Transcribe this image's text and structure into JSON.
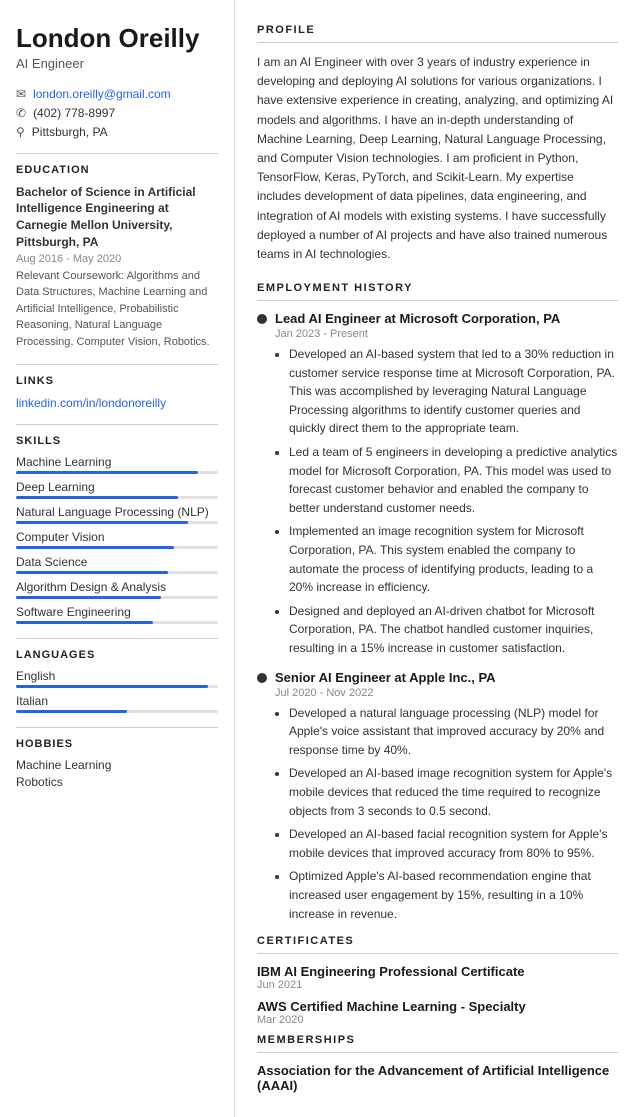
{
  "sidebar": {
    "name": "London Oreilly",
    "job_title": "AI Engineer",
    "contact": {
      "email": "london.oreilly@gmail.com",
      "phone": "(402) 778-8997",
      "location": "Pittsburgh, PA"
    },
    "education_section": "EDUCATION",
    "education": {
      "degree": "Bachelor of Science in Artificial Intelligence Engineering at Carnegie Mellon University, Pittsburgh, PA",
      "date": "Aug 2016 - May 2020",
      "coursework": "Relevant Coursework: Algorithms and Data Structures, Machine Learning and Artificial Intelligence, Probabilistic Reasoning, Natural Language Processing, Computer Vision, Robotics."
    },
    "links_section": "LINKS",
    "link": "linkedin.com/in/londonoreilly",
    "skills_section": "SKILLS",
    "skills": [
      {
        "label": "Machine Learning",
        "pct": 90
      },
      {
        "label": "Deep Learning",
        "pct": 80
      },
      {
        "label": "Natural Language Processing (NLP)",
        "pct": 85
      },
      {
        "label": "Computer Vision",
        "pct": 78
      },
      {
        "label": "Data Science",
        "pct": 75
      },
      {
        "label": "Algorithm Design & Analysis",
        "pct": 72
      },
      {
        "label": "Software Engineering",
        "pct": 68
      }
    ],
    "languages_section": "LANGUAGES",
    "languages": [
      {
        "label": "English",
        "pct": 95
      },
      {
        "label": "Italian",
        "pct": 55
      }
    ],
    "hobbies_section": "HOBBIES",
    "hobbies": [
      "Machine Learning",
      "Robotics"
    ]
  },
  "main": {
    "profile_section": "PROFILE",
    "profile_text": "I am an AI Engineer with over 3 years of industry experience in developing and deploying AI solutions for various organizations. I have extensive experience in creating, analyzing, and optimizing AI models and algorithms. I have an in-depth understanding of Machine Learning, Deep Learning, Natural Language Processing, and Computer Vision technologies. I am proficient in Python, TensorFlow, Keras, PyTorch, and Scikit-Learn. My expertise includes development of data pipelines, data engineering, and integration of AI models with existing systems. I have successfully deployed a number of AI projects and have also trained numerous teams in AI technologies.",
    "employment_section": "EMPLOYMENT HISTORY",
    "jobs": [
      {
        "title": "Lead AI Engineer at Microsoft Corporation, PA",
        "date": "Jan 2023 - Present",
        "bullets": [
          "Developed an AI-based system that led to a 30% reduction in customer service response time at Microsoft Corporation, PA. This was accomplished by leveraging Natural Language Processing algorithms to identify customer queries and quickly direct them to the appropriate team.",
          "Led a team of 5 engineers in developing a predictive analytics model for Microsoft Corporation, PA. This model was used to forecast customer behavior and enabled the company to better understand customer needs.",
          "Implemented an image recognition system for Microsoft Corporation, PA. This system enabled the company to automate the process of identifying products, leading to a 20% increase in efficiency.",
          "Designed and deployed an AI-driven chatbot for Microsoft Corporation, PA. The chatbot handled customer inquiries, resulting in a 15% increase in customer satisfaction."
        ]
      },
      {
        "title": "Senior AI Engineer at Apple Inc., PA",
        "date": "Jul 2020 - Nov 2022",
        "bullets": [
          "Developed a natural language processing (NLP) model for Apple's voice assistant that improved accuracy by 20% and response time by 40%.",
          "Developed an AI-based image recognition system for Apple's mobile devices that reduced the time required to recognize objects from 3 seconds to 0.5 second.",
          "Developed an AI-based facial recognition system for Apple's mobile devices that improved accuracy from 80% to 95%.",
          "Optimized Apple's AI-based recommendation engine that increased user engagement by 15%, resulting in a 10% increase in revenue."
        ]
      }
    ],
    "certificates_section": "CERTIFICATES",
    "certificates": [
      {
        "title": "IBM AI Engineering Professional Certificate",
        "date": "Jun 2021"
      },
      {
        "title": "AWS Certified Machine Learning - Specialty",
        "date": "Mar 2020"
      }
    ],
    "memberships_section": "MEMBERSHIPS",
    "memberships": [
      {
        "title": "Association for the Advancement of Artificial Intelligence (AAAI)"
      }
    ]
  }
}
